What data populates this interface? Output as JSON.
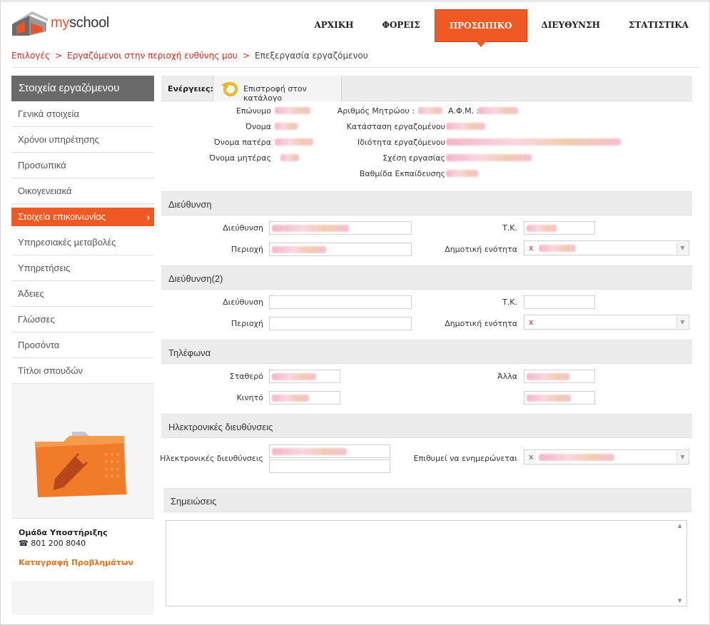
{
  "header": {
    "logo_text_prefix": "my",
    "logo_text_suffix": "school",
    "nav": [
      "ΑΡΧΙΚΗ",
      "ΦΟΡΕΙΣ",
      "ΠΡΟΣΩΠΙΚΟ",
      "ΔΙΕΥΘΥΝΣΗ",
      "ΣΤΑΤΙΣΤΙΚΑ"
    ],
    "active_nav": "ΠΡΟΣΩΠΙΚΟ"
  },
  "breadcrumb": {
    "items": [
      "Επιλογές",
      "Εργαζόμενοι στην περιοχή ευθύνης μου"
    ],
    "separator": ">",
    "current": "Επεξεργασία εργαζόμενου"
  },
  "sidebar": {
    "title": "Στοιχεία εργαζόμενου",
    "items": [
      "Γενικά στοιχεία",
      "Χρόνοι υπηρέτησης",
      "Προσωπικά",
      "Οικογενειακά",
      "Στοιχεία επικοινωνίας",
      "Υπηρεσιακές μεταβολές",
      "Υπηρετήσεις",
      "Άδειες",
      "Γλώσσες",
      "Προσόντα",
      "Τίτλοι σπουδών"
    ],
    "active_item": "Στοιχεία επικοινωνίας",
    "support_title": "Ομάδα Υποστήριξης",
    "support_phone": "801 200 8040",
    "report_link": "Καταγραφή Προβλημάτων"
  },
  "actions": {
    "label": "Ενέργειες:",
    "back_button": "Επιστροφή στον κατάλογο"
  },
  "employee": {
    "left_labels": [
      "Επώνυμο",
      "Όνομα",
      "Όνομα πατέρα",
      "Όνομα μητέρας"
    ],
    "right_labels": [
      "Αριθμός Μητρώου :",
      "Κατάσταση εργαζομένου",
      "Ιδιότητα εργαζόμενου",
      "Σχέση εργασίας",
      "Βαθμίδα Εκπαίδευσης"
    ],
    "afm_label": "Α.Φ.Μ. :"
  },
  "address": {
    "title": "Διεύθυνση",
    "street_label": "Διεύθυνση",
    "area_label": "Περιοχή",
    "zip_label": "Τ.Κ.",
    "municipality_label": "Δημοτική ενότητα",
    "clear_mark": "x"
  },
  "address2": {
    "title": "Διεύθυνση(2)",
    "street_label": "Διεύθυνση",
    "area_label": "Περιοχή",
    "zip_label": "Τ.Κ.",
    "municipality_label": "Δημοτική ενότητα",
    "clear_mark": "x"
  },
  "phones": {
    "title": "Τηλέφωνα",
    "landline_label": "Σταθερό",
    "mobile_label": "Κινητό",
    "other_label": "Άλλα"
  },
  "emails": {
    "title": "Ηλεκτρονικές διευθύνσεις",
    "label": "Ηλεκτρονικές διευθύνσεις",
    "notify_label": "Επιθυμεί να ενημερώνεται",
    "clear_mark": "x"
  },
  "notes": {
    "title": "Σημειώσεις"
  },
  "colors": {
    "accent": "#ef5a24",
    "link": "#d22e1f",
    "sidebar_title_bg": "#6a6a6a",
    "support_link": "#e8731a"
  }
}
